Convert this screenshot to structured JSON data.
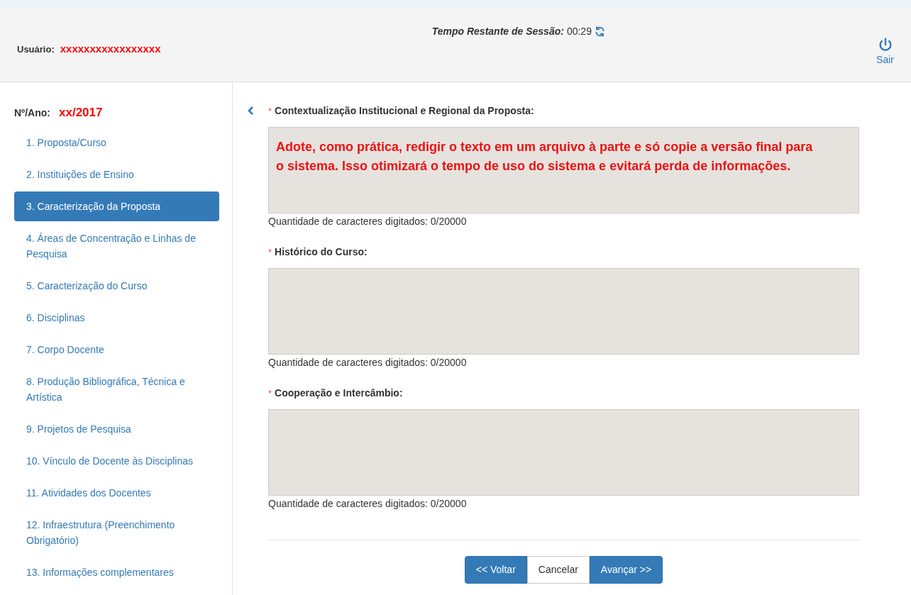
{
  "header": {
    "user_label": "Usuário:",
    "user_value": "xxxxxxxxxxxxxxxxx",
    "session_label": "Tempo Restante de Sessão:",
    "session_time": "00:29",
    "logout": "Sair"
  },
  "sidebar": {
    "number_label": "Nº/Ano:",
    "number_value": "xx/2017",
    "items": [
      {
        "label": "1. Proposta/Curso",
        "selected": false
      },
      {
        "label": "2. Instituições de Ensino",
        "selected": false
      },
      {
        "label": "3. Caracterização da Proposta",
        "selected": true
      },
      {
        "label": "4. Áreas de Concentração e Linhas de Pesquisa",
        "selected": false
      },
      {
        "label": "5. Caracterização do Curso",
        "selected": false
      },
      {
        "label": "6. Disciplinas",
        "selected": false
      },
      {
        "label": "7. Corpo Docente",
        "selected": false
      },
      {
        "label": "8. Produção Bibliográfica, Técnica e Artística",
        "selected": false
      },
      {
        "label": "9. Projetos de Pesquisa",
        "selected": false
      },
      {
        "label": "10. Vínculo de Docente às Disciplinas",
        "selected": false
      },
      {
        "label": "11. Atividades dos Docentes",
        "selected": false
      },
      {
        "label": "12. Infraestrutura (Preenchimento Obrigatório)",
        "selected": false
      },
      {
        "label": "13. Informações complementares",
        "selected": false
      }
    ]
  },
  "fields": [
    {
      "required_mark": "*",
      "label": "Contextualização Institucional e Regional da Proposta:",
      "value": "Adote, como prática, redigir o texto em um arquivo à parte e só copie a versão final para o sistema. Isso otimizará o tempo de uso do sistema e evitará perda de informações.",
      "counter": "Quantidade de caracteres digitados: 0/20000"
    },
    {
      "required_mark": "*",
      "label": "Histórico do Curso:",
      "counter": "Quantidade de caracteres digitados: 0/20000"
    },
    {
      "required_mark": "*",
      "label": "Cooperação e Intercâmbio:",
      "counter": "Quantidade de caracteres digitados: 0/20000"
    }
  ],
  "buttons": [
    {
      "label": "<< Voltar",
      "kind": "primary"
    },
    {
      "label": "Cancelar",
      "kind": "default"
    },
    {
      "label": "Avançar >>",
      "kind": "primary"
    }
  ]
}
